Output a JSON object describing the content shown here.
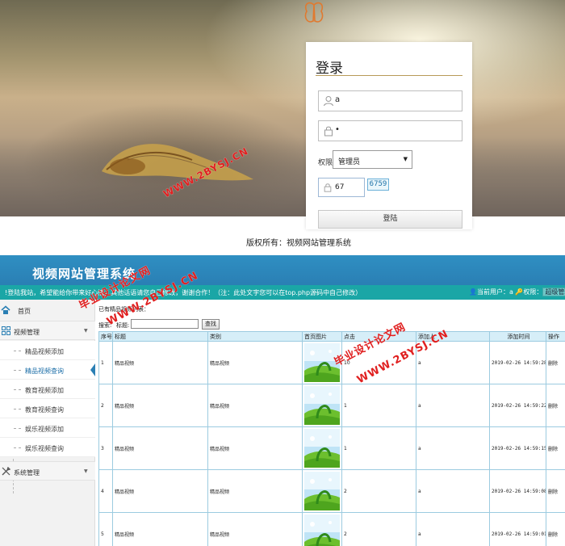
{
  "login": {
    "title": "登录",
    "username_value": "a",
    "password_value": "•",
    "role_label": "权限:",
    "role_selected": "管理员",
    "captcha_value": "67",
    "captcha_code": "6759",
    "login_button": "登陆",
    "copyright": "版权所有：视频网站管理系统"
  },
  "admin": {
    "site_title": "视频网站管理系统",
    "notice": "!登陆我站，希望能给你带来好心情，其他话语请您自己修改，谢谢合作！（注：此处文字您可以在top.php源码中自己修改）",
    "current_user_label": "当前用户：",
    "current_user": "a",
    "role_label": "权限：",
    "role_value": "超级管理"
  },
  "sidebar": {
    "home": "首页",
    "groups": [
      {
        "label": "视频管理",
        "items": [
          "精品视频添加",
          "精品视频查询",
          "教育视频添加",
          "教育视频查询",
          "娱乐视频添加",
          "娱乐视频查询"
        ]
      },
      {
        "label": "系统管理"
      }
    ]
  },
  "content": {
    "list_title": "已有精品视频列表：",
    "search_label": "搜索:",
    "search_field_label": "标题:",
    "search_button": "查找",
    "columns": [
      "序号",
      "标题",
      "类别",
      "首页图片",
      "点击",
      "添加人",
      "添加时间",
      "操作"
    ],
    "rows": [
      {
        "no": "1",
        "title": "精品视频",
        "category": "精品视频",
        "clicks": "10",
        "adder": "a",
        "time": "2019-02-26 14:59:28",
        "action": "删除"
      },
      {
        "no": "2",
        "title": "精品视频",
        "category": "精品视频",
        "clicks": "1",
        "adder": "a",
        "time": "2019-02-26 14:59:22",
        "action": "删除"
      },
      {
        "no": "3",
        "title": "精品视频",
        "category": "精品视频",
        "clicks": "1",
        "adder": "a",
        "time": "2019-02-26 14:59:15",
        "action": "删除"
      },
      {
        "no": "4",
        "title": "精品视频",
        "category": "精品视频",
        "clicks": "2",
        "adder": "a",
        "time": "2019-02-26 14:59:08",
        "action": "删除"
      },
      {
        "no": "5",
        "title": "精品视频",
        "category": "精品视频",
        "clicks": "2",
        "adder": "a",
        "time": "2019-02-26 14:59:01",
        "action": "删除"
      }
    ]
  },
  "watermark": {
    "line1": "毕业设计论文网",
    "line2": "WWW.2BYSJ.CN"
  }
}
